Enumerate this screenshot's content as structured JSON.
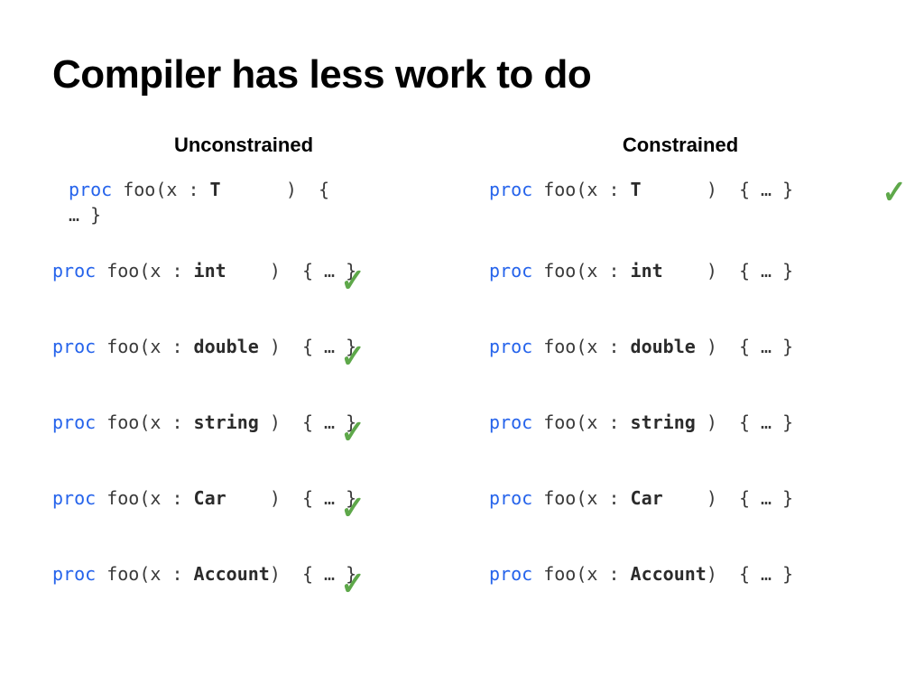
{
  "title": "Compiler has less work to do",
  "columns": {
    "left": {
      "header": "Unconstrained",
      "rows": [
        {
          "kind": "generic",
          "keyword": "proc",
          "name": "foo",
          "param": "x",
          "type": "T",
          "body": "{ … }",
          "indented": true,
          "checked": false
        },
        {
          "kind": "concrete",
          "keyword": "proc",
          "name": "foo",
          "param": "x",
          "type": "int",
          "body": "{ … }",
          "indented": false,
          "checked": true
        },
        {
          "kind": "concrete",
          "keyword": "proc",
          "name": "foo",
          "param": "x",
          "type": "double",
          "body": "{ … }",
          "indented": false,
          "checked": true
        },
        {
          "kind": "concrete",
          "keyword": "proc",
          "name": "foo",
          "param": "x",
          "type": "string",
          "body": "{ … }",
          "indented": false,
          "checked": true
        },
        {
          "kind": "concrete",
          "keyword": "proc",
          "name": "foo",
          "param": "x",
          "type": "Car",
          "body": "{ … }",
          "indented": false,
          "checked": true
        },
        {
          "kind": "concrete",
          "keyword": "proc",
          "name": "foo",
          "param": "x",
          "type": "Account",
          "body": "{ … }",
          "indented": false,
          "checked": true
        }
      ]
    },
    "right": {
      "header": "Constrained",
      "rows": [
        {
          "kind": "generic",
          "keyword": "proc",
          "name": "foo",
          "param": "x",
          "type": "T",
          "body": "{ … }",
          "indented": false,
          "checked": true
        },
        {
          "kind": "concrete",
          "keyword": "proc",
          "name": "foo",
          "param": "x",
          "type": "int",
          "body": "{ … }",
          "indented": false,
          "checked": false
        },
        {
          "kind": "concrete",
          "keyword": "proc",
          "name": "foo",
          "param": "x",
          "type": "double",
          "body": "{ … }",
          "indented": false,
          "checked": false
        },
        {
          "kind": "concrete",
          "keyword": "proc",
          "name": "foo",
          "param": "x",
          "type": "string",
          "body": "{ … }",
          "indented": false,
          "checked": false
        },
        {
          "kind": "concrete",
          "keyword": "proc",
          "name": "foo",
          "param": "x",
          "type": "Car",
          "body": "{ … }",
          "indented": false,
          "checked": false
        },
        {
          "kind": "concrete",
          "keyword": "proc",
          "name": "foo",
          "param": "x",
          "type": "Account",
          "body": "{ … }",
          "indented": false,
          "checked": false
        }
      ]
    }
  },
  "check_glyph": "✓",
  "type_pad_width": 7
}
